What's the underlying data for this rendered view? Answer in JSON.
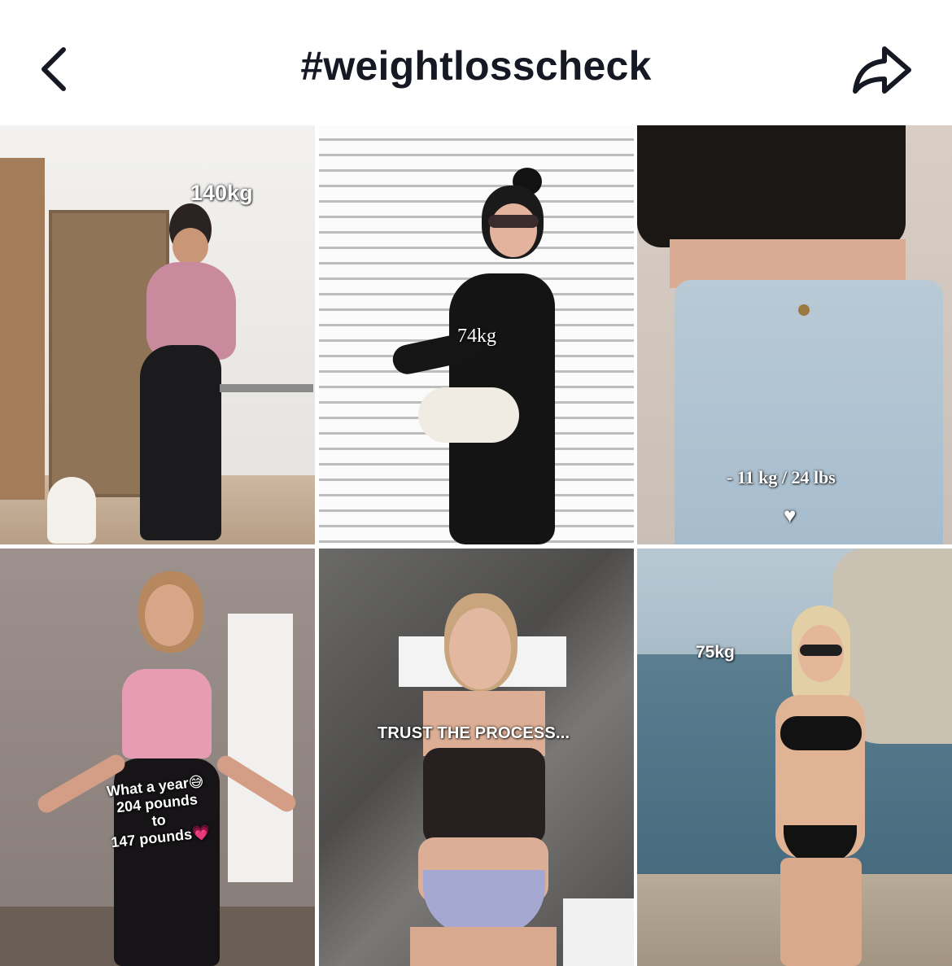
{
  "header": {
    "title": "#weightlosscheck",
    "back_icon": "chevron-left-icon",
    "share_icon": "share-arrow-icon"
  },
  "videos": [
    {
      "overlay": "140kg"
    },
    {
      "overlay": "74kg"
    },
    {
      "overlay": "- 11 kg / 24 lbs",
      "emoji": "♥"
    },
    {
      "overlay_lines": [
        "What a year",
        "204 pounds",
        "to",
        "147 pounds"
      ],
      "emoji_1": "😅",
      "emoji_2": "💗"
    },
    {
      "overlay": "TRUST THE PROCESS..."
    },
    {
      "overlay": "75kg"
    }
  ],
  "colors": {
    "text": "#161823",
    "background": "#ffffff"
  }
}
